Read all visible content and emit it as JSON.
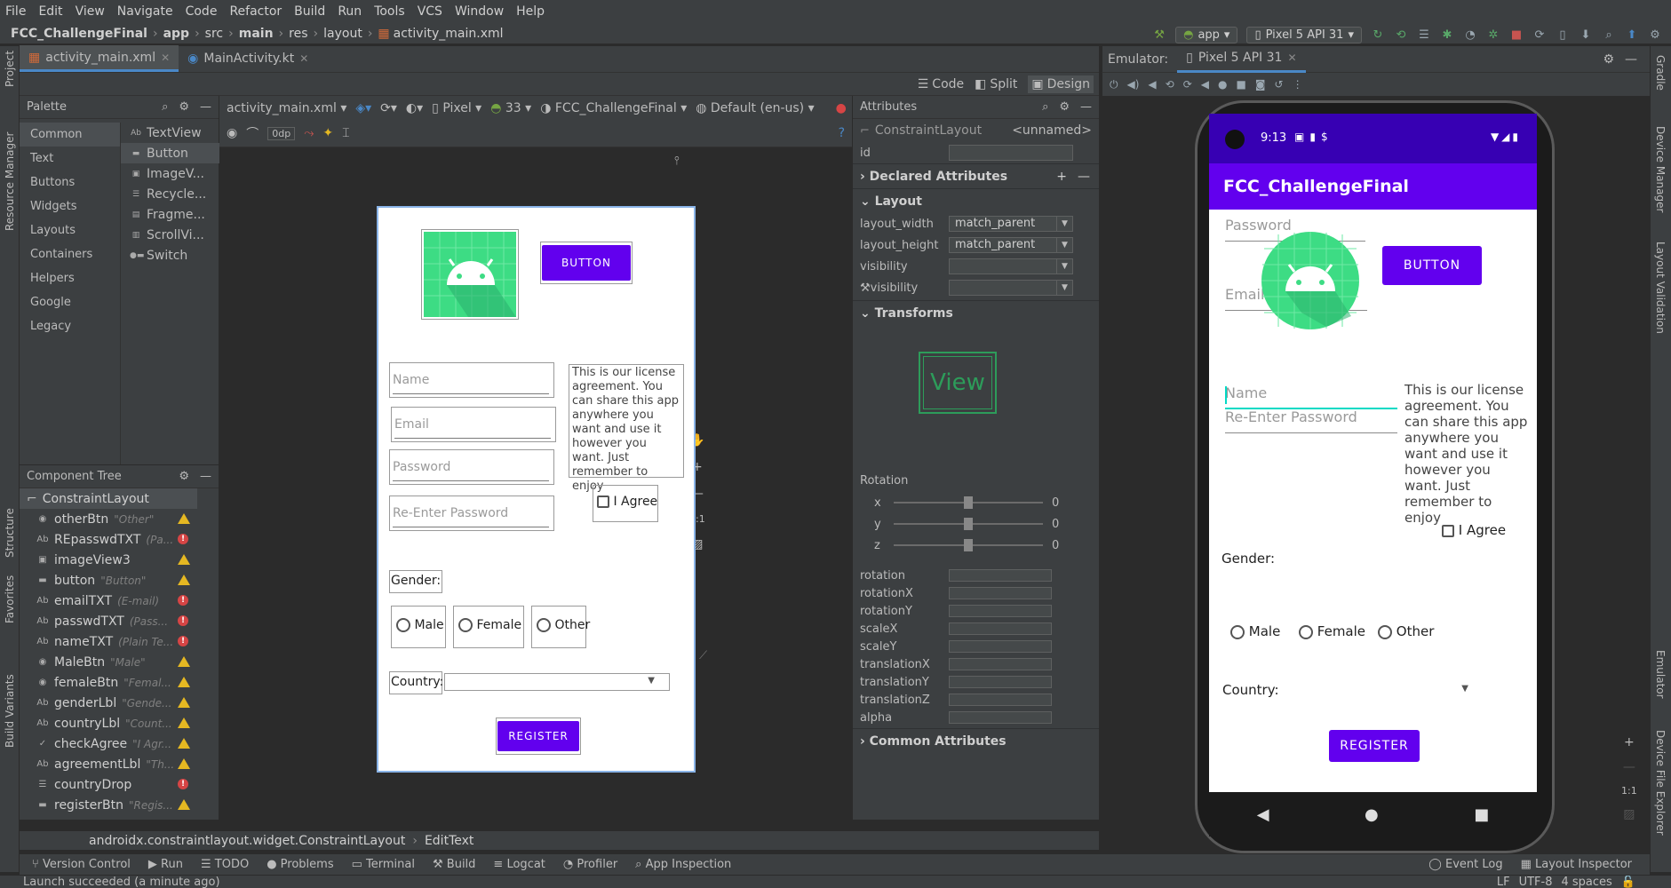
{
  "menu": [
    "File",
    "Edit",
    "View",
    "Navigate",
    "Code",
    "Refactor",
    "Build",
    "Run",
    "Tools",
    "VCS",
    "Window",
    "Help"
  ],
  "breadcrumb": [
    "FCC_ChallengeFinal",
    "app",
    "src",
    "main",
    "res",
    "layout",
    "activity_main.xml"
  ],
  "toolbar": {
    "run_config": "app",
    "device": "Pixel 5 API 31"
  },
  "editor_tabs": [
    {
      "label": "activity_main.xml",
      "active": true
    },
    {
      "label": "MainActivity.kt",
      "active": false
    }
  ],
  "view_modes": {
    "code": "Code",
    "split": "Split",
    "design": "Design"
  },
  "left_tools": {
    "project": "Project",
    "resource_manager": "Resource Manager",
    "structure": "Structure",
    "favorites": "Favorites",
    "build_variants": "Build Variants"
  },
  "right_tools": {
    "gradle": "Gradle",
    "device_manager": "Device Manager",
    "layout_validation": "Layout Validation",
    "emulator": "Emulator",
    "device_file_explorer": "Device File Explorer"
  },
  "palette": {
    "title": "Palette",
    "categories": [
      "Common",
      "Text",
      "Buttons",
      "Widgets",
      "Layouts",
      "Containers",
      "Helpers",
      "Google",
      "Legacy"
    ],
    "items": [
      "TextView",
      "Button",
      "ImageV...",
      "Recycle...",
      "Fragme...",
      "ScrollVi...",
      "Switch"
    ],
    "item_icons": [
      "Ab",
      "▬",
      "▣",
      "☰",
      "▤",
      "▥",
      "●▬"
    ]
  },
  "component_tree": {
    "title": "Component Tree",
    "root": "ConstraintLayout",
    "items": [
      {
        "icon": "◉",
        "name": "otherBtn",
        "hint": "\"Other\"",
        "status": "warn"
      },
      {
        "icon": "Ab",
        "name": "REpasswdTXT",
        "hint": "(Pa...",
        "status": "err"
      },
      {
        "icon": "▣",
        "name": "imageView3",
        "hint": "",
        "status": "warn"
      },
      {
        "icon": "▬",
        "name": "button",
        "hint": "\"Button\"",
        "status": "warn"
      },
      {
        "icon": "Ab",
        "name": "emailTXT",
        "hint": "(E-mail)",
        "status": "err"
      },
      {
        "icon": "Ab",
        "name": "passwdTXT",
        "hint": "(Pass...",
        "status": "err"
      },
      {
        "icon": "Ab",
        "name": "nameTXT",
        "hint": "(Plain Te...",
        "status": "err"
      },
      {
        "icon": "◉",
        "name": "MaleBtn",
        "hint": "\"Male\"",
        "status": "warn"
      },
      {
        "icon": "◉",
        "name": "femaleBtn",
        "hint": "\"Femal...",
        "status": "warn"
      },
      {
        "icon": "Ab",
        "name": "genderLbl",
        "hint": "\"Gende...",
        "status": "warn"
      },
      {
        "icon": "Ab",
        "name": "countryLbl",
        "hint": "\"Count...",
        "status": "warn"
      },
      {
        "icon": "✓",
        "name": "checkAgree",
        "hint": "\"I Agr...",
        "status": "warn"
      },
      {
        "icon": "Ab",
        "name": "agreementLbl",
        "hint": "\"Th...",
        "status": "warn"
      },
      {
        "icon": "☰",
        "name": "countryDrop",
        "hint": "",
        "status": "err"
      },
      {
        "icon": "▬",
        "name": "registerBtn",
        "hint": "\"Regis...",
        "status": "warn"
      }
    ]
  },
  "canvas_toolbar": {
    "file": "activity_main.xml",
    "device": "Pixel",
    "api": "33",
    "theme": "FCC_ChallengeFinal",
    "locale": "Default (en-us)",
    "margin": "0dp"
  },
  "design": {
    "button": "BUTTON",
    "name_hint": "Name",
    "email_hint": "Email",
    "password_hint": "Password",
    "repassword_hint": "Re-Enter Password",
    "agreement": "This is our license agreement. You can share this app anywhere you want and use it however you want. Just remember to enjoy",
    "agree": "I Agree",
    "gender": "Gender:",
    "male": "Male",
    "female": "Female",
    "other": "Other",
    "country": "Country:",
    "register": "REGISTER"
  },
  "attributes": {
    "title": "Attributes",
    "component": "ConstraintLayout",
    "component_name": "<unnamed>",
    "id_label": "id",
    "declared": "Declared Attributes",
    "layout": "Layout",
    "layout_width_label": "layout_width",
    "layout_width": "match_parent",
    "layout_height_label": "layout_height",
    "layout_height": "match_parent",
    "visibility_label": "visibility",
    "tools_visibility_label": "visibility",
    "transforms": "Transforms",
    "view_preview": "View",
    "rotation_title": "Rotation",
    "rotation": [
      {
        "axis": "x",
        "value": "0"
      },
      {
        "axis": "y",
        "value": "0"
      },
      {
        "axis": "z",
        "value": "0"
      }
    ],
    "transform_fields": [
      "rotation",
      "rotationX",
      "rotationY",
      "scaleX",
      "scaleY",
      "translationX",
      "translationY",
      "translationZ",
      "alpha"
    ],
    "common": "Common Attributes"
  },
  "status_crumb": [
    "androidx.constraintlayout.widget.ConstraintLayout",
    "EditText"
  ],
  "bottom_tools": [
    "Version Control",
    "Run",
    "TODO",
    "Problems",
    "Terminal",
    "Build",
    "Logcat",
    "Profiler",
    "App Inspection"
  ],
  "bottom_right_tools": [
    "Event Log",
    "Layout Inspector"
  ],
  "status": {
    "message": "Launch succeeded (a minute ago)",
    "line_sep": "LF",
    "encoding": "UTF-8",
    "indent": "4 spaces"
  },
  "emulator": {
    "label": "Emulator:",
    "tab": "Pixel 5 API 31",
    "zoom": "1:1",
    "phone": {
      "time": "9:13",
      "app_title": "FCC_ChallengeFinal",
      "password_hint": "Password",
      "email_hint": "Email",
      "button": "BUTTON",
      "name_hint": "Name",
      "repassword_hint": "Re-Enter Password",
      "agreement": "This is our license agreement. You can share this app anywhere you want and use it however you want. Just remember to enjoy",
      "agree": "I Agree",
      "gender": "Gender:",
      "male": "Male",
      "female": "Female",
      "other": "Other",
      "country": "Country:",
      "register": "REGISTER"
    }
  },
  "canvas_zoom": {
    "zoom": "1:1"
  },
  "colors": {
    "accent": "#6200ee",
    "status_bar": "#3700b3",
    "android_green": "#3ddc84",
    "ide_bg": "#2b2b2b",
    "panel": "#3c3f41"
  }
}
